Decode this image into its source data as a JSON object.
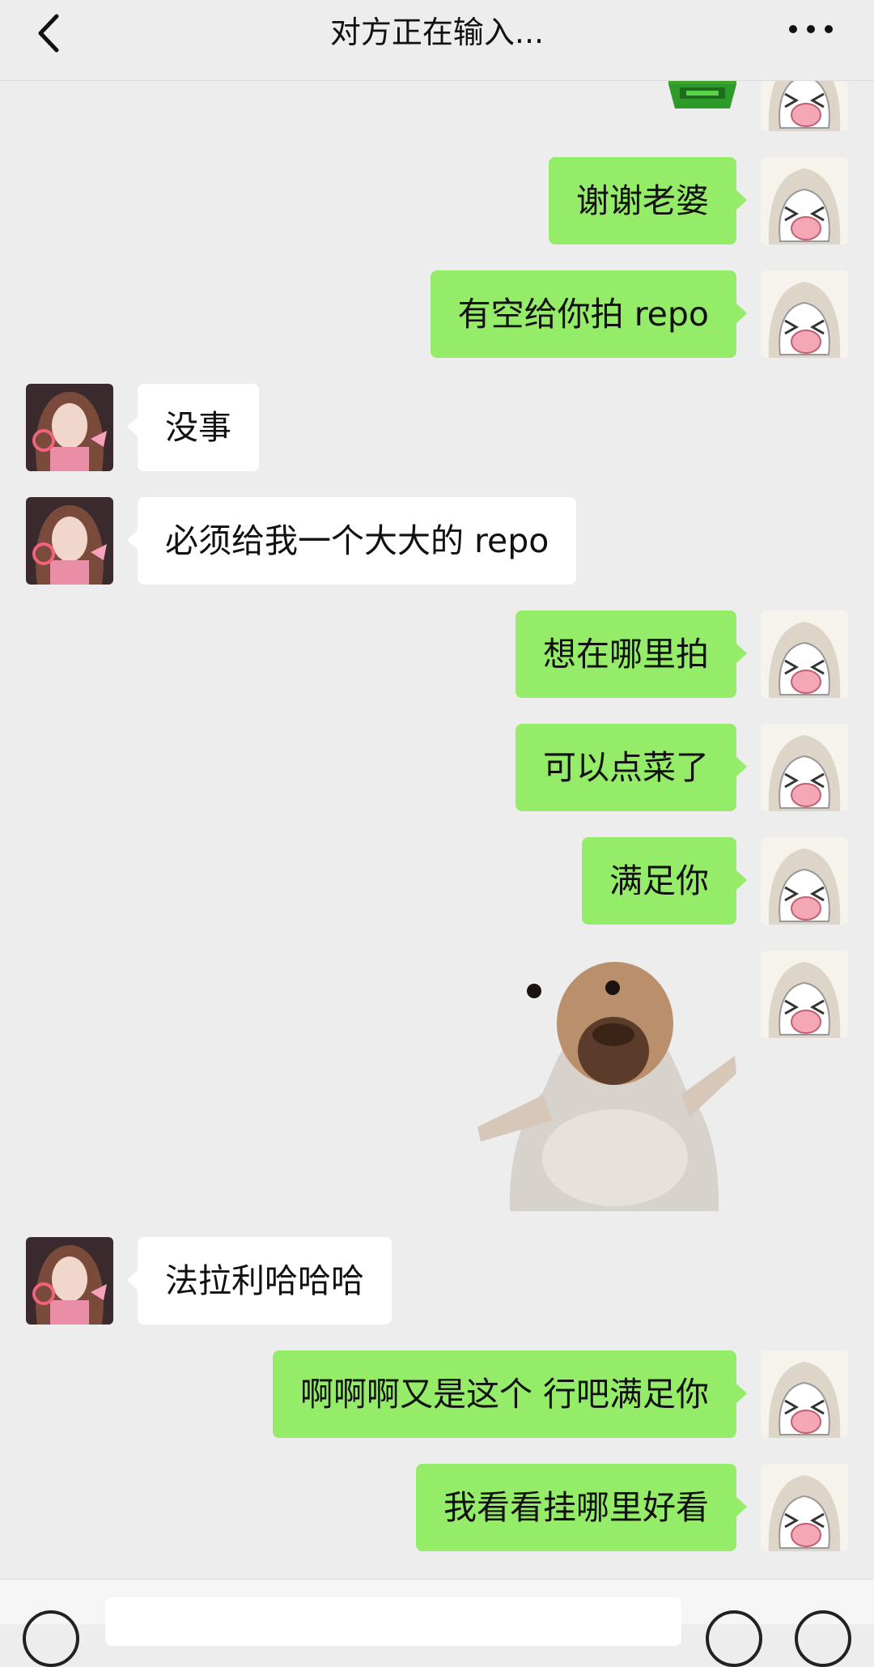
{
  "header": {
    "title": "对方正在输入..."
  },
  "messages": [
    {
      "side": "right",
      "type": "sticker",
      "sticker": "green-sticker-partial"
    },
    {
      "side": "right",
      "type": "text",
      "text": "谢谢老婆"
    },
    {
      "side": "right",
      "type": "text",
      "text": "有空给你拍 repo"
    },
    {
      "side": "left",
      "type": "text",
      "text": "没事"
    },
    {
      "side": "left",
      "type": "text",
      "text": "必须给我一个大大的 repo"
    },
    {
      "side": "right",
      "type": "text",
      "text": "想在哪里拍"
    },
    {
      "side": "right",
      "type": "text",
      "text": "可以点菜了"
    },
    {
      "side": "right",
      "type": "text",
      "text": "满足你"
    },
    {
      "side": "right",
      "type": "sticker",
      "sticker": "hamster-arms-open-sticker"
    },
    {
      "side": "left",
      "type": "text",
      "text": "法拉利哈哈哈"
    },
    {
      "side": "right",
      "type": "text",
      "text": "啊啊啊又是这个 行吧满足你"
    },
    {
      "side": "right",
      "type": "text",
      "text": "我看看挂哪里好看"
    }
  ],
  "icons": {
    "back": "chevron-left-icon",
    "more": "more-dots-icon",
    "voice": "voice-icon",
    "emoji": "emoji-icon",
    "plus": "plus-icon"
  },
  "colors": {
    "background": "#ededed",
    "self_bubble": "#95ec69",
    "other_bubble": "#ffffff"
  }
}
